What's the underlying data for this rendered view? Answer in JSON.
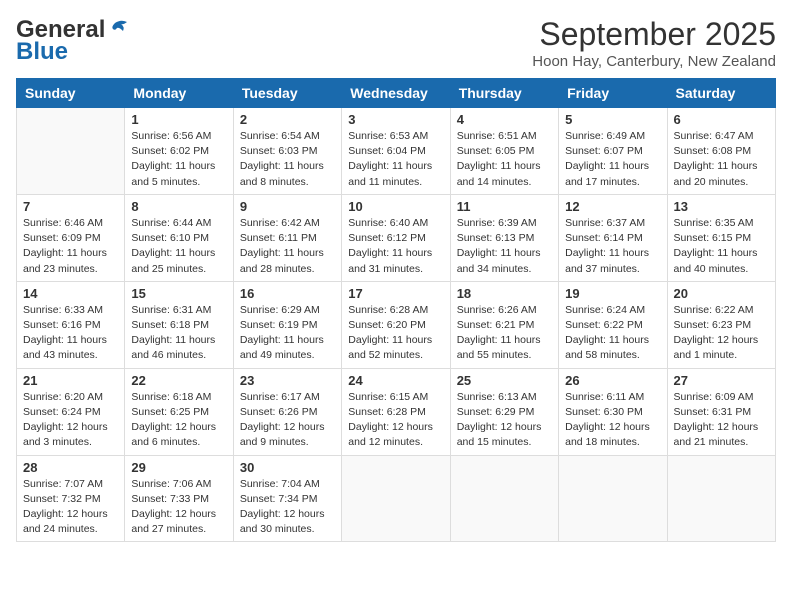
{
  "header": {
    "logo_general": "General",
    "logo_blue": "Blue",
    "month": "September 2025",
    "location": "Hoon Hay, Canterbury, New Zealand"
  },
  "days_of_week": [
    "Sunday",
    "Monday",
    "Tuesday",
    "Wednesday",
    "Thursday",
    "Friday",
    "Saturday"
  ],
  "weeks": [
    [
      {
        "day": "",
        "info": ""
      },
      {
        "day": "1",
        "info": "Sunrise: 6:56 AM\nSunset: 6:02 PM\nDaylight: 11 hours\nand 5 minutes."
      },
      {
        "day": "2",
        "info": "Sunrise: 6:54 AM\nSunset: 6:03 PM\nDaylight: 11 hours\nand 8 minutes."
      },
      {
        "day": "3",
        "info": "Sunrise: 6:53 AM\nSunset: 6:04 PM\nDaylight: 11 hours\nand 11 minutes."
      },
      {
        "day": "4",
        "info": "Sunrise: 6:51 AM\nSunset: 6:05 PM\nDaylight: 11 hours\nand 14 minutes."
      },
      {
        "day": "5",
        "info": "Sunrise: 6:49 AM\nSunset: 6:07 PM\nDaylight: 11 hours\nand 17 minutes."
      },
      {
        "day": "6",
        "info": "Sunrise: 6:47 AM\nSunset: 6:08 PM\nDaylight: 11 hours\nand 20 minutes."
      }
    ],
    [
      {
        "day": "7",
        "info": "Sunrise: 6:46 AM\nSunset: 6:09 PM\nDaylight: 11 hours\nand 23 minutes."
      },
      {
        "day": "8",
        "info": "Sunrise: 6:44 AM\nSunset: 6:10 PM\nDaylight: 11 hours\nand 25 minutes."
      },
      {
        "day": "9",
        "info": "Sunrise: 6:42 AM\nSunset: 6:11 PM\nDaylight: 11 hours\nand 28 minutes."
      },
      {
        "day": "10",
        "info": "Sunrise: 6:40 AM\nSunset: 6:12 PM\nDaylight: 11 hours\nand 31 minutes."
      },
      {
        "day": "11",
        "info": "Sunrise: 6:39 AM\nSunset: 6:13 PM\nDaylight: 11 hours\nand 34 minutes."
      },
      {
        "day": "12",
        "info": "Sunrise: 6:37 AM\nSunset: 6:14 PM\nDaylight: 11 hours\nand 37 minutes."
      },
      {
        "day": "13",
        "info": "Sunrise: 6:35 AM\nSunset: 6:15 PM\nDaylight: 11 hours\nand 40 minutes."
      }
    ],
    [
      {
        "day": "14",
        "info": "Sunrise: 6:33 AM\nSunset: 6:16 PM\nDaylight: 11 hours\nand 43 minutes."
      },
      {
        "day": "15",
        "info": "Sunrise: 6:31 AM\nSunset: 6:18 PM\nDaylight: 11 hours\nand 46 minutes."
      },
      {
        "day": "16",
        "info": "Sunrise: 6:29 AM\nSunset: 6:19 PM\nDaylight: 11 hours\nand 49 minutes."
      },
      {
        "day": "17",
        "info": "Sunrise: 6:28 AM\nSunset: 6:20 PM\nDaylight: 11 hours\nand 52 minutes."
      },
      {
        "day": "18",
        "info": "Sunrise: 6:26 AM\nSunset: 6:21 PM\nDaylight: 11 hours\nand 55 minutes."
      },
      {
        "day": "19",
        "info": "Sunrise: 6:24 AM\nSunset: 6:22 PM\nDaylight: 11 hours\nand 58 minutes."
      },
      {
        "day": "20",
        "info": "Sunrise: 6:22 AM\nSunset: 6:23 PM\nDaylight: 12 hours\nand 1 minute."
      }
    ],
    [
      {
        "day": "21",
        "info": "Sunrise: 6:20 AM\nSunset: 6:24 PM\nDaylight: 12 hours\nand 3 minutes."
      },
      {
        "day": "22",
        "info": "Sunrise: 6:18 AM\nSunset: 6:25 PM\nDaylight: 12 hours\nand 6 minutes."
      },
      {
        "day": "23",
        "info": "Sunrise: 6:17 AM\nSunset: 6:26 PM\nDaylight: 12 hours\nand 9 minutes."
      },
      {
        "day": "24",
        "info": "Sunrise: 6:15 AM\nSunset: 6:28 PM\nDaylight: 12 hours\nand 12 minutes."
      },
      {
        "day": "25",
        "info": "Sunrise: 6:13 AM\nSunset: 6:29 PM\nDaylight: 12 hours\nand 15 minutes."
      },
      {
        "day": "26",
        "info": "Sunrise: 6:11 AM\nSunset: 6:30 PM\nDaylight: 12 hours\nand 18 minutes."
      },
      {
        "day": "27",
        "info": "Sunrise: 6:09 AM\nSunset: 6:31 PM\nDaylight: 12 hours\nand 21 minutes."
      }
    ],
    [
      {
        "day": "28",
        "info": "Sunrise: 7:07 AM\nSunset: 7:32 PM\nDaylight: 12 hours\nand 24 minutes."
      },
      {
        "day": "29",
        "info": "Sunrise: 7:06 AM\nSunset: 7:33 PM\nDaylight: 12 hours\nand 27 minutes."
      },
      {
        "day": "30",
        "info": "Sunrise: 7:04 AM\nSunset: 7:34 PM\nDaylight: 12 hours\nand 30 minutes."
      },
      {
        "day": "",
        "info": ""
      },
      {
        "day": "",
        "info": ""
      },
      {
        "day": "",
        "info": ""
      },
      {
        "day": "",
        "info": ""
      }
    ]
  ]
}
